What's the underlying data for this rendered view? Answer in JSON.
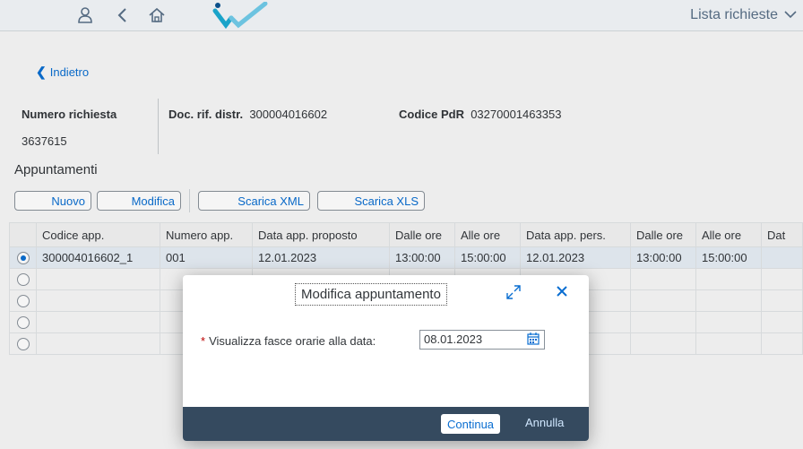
{
  "shell": {
    "title": "Lista richieste",
    "icons": [
      "user-icon",
      "back-arrow-icon",
      "home-icon",
      "logo"
    ]
  },
  "nav": {
    "back_label": "Indietro"
  },
  "header": {
    "request_label": "Numero richiesta",
    "request_value": "3637615",
    "doc_label": "Doc. rif. distr.",
    "doc_value": "300004016602",
    "pdr_label": "Codice PdR",
    "pdr_value": "03270001463353"
  },
  "section_title": "Appuntamenti",
  "toolbar": {
    "nuovo": "Nuovo",
    "modifica": "Modifica",
    "scarica_xml": "Scarica XML",
    "scarica_xls": "Scarica XLS"
  },
  "table": {
    "columns": [
      "Codice app.",
      "Numero app.",
      "Data app. proposto",
      "Dalle ore",
      "Alle ore",
      "Data app. pers.",
      "Dalle ore",
      "Alle ore",
      "Dat"
    ],
    "rows": [
      [
        "300004016602_1",
        "001",
        "12.01.2023",
        "13:00:00",
        "15:00:00",
        "12.01.2023",
        "13:00:00",
        "15:00:00",
        ""
      ],
      [
        "",
        "",
        "",
        "",
        "",
        "",
        "",
        "",
        ""
      ],
      [
        "",
        "",
        "",
        "",
        "",
        "",
        "",
        "",
        ""
      ],
      [
        "",
        "",
        "",
        "",
        "",
        "",
        "",
        "",
        ""
      ],
      [
        "",
        "",
        "",
        "",
        "",
        "",
        "",
        "",
        ""
      ]
    ],
    "selected_row": 0
  },
  "dialog": {
    "title": "Modifica appuntamento",
    "field_label": "Visualizza fasce orarie alla data:",
    "field_value": "08.01.2023",
    "continua": "Continua",
    "annulla": "Annulla"
  },
  "colors": {
    "accent": "#0a6ed1",
    "footer": "#354a5f",
    "required": "#bb0000"
  }
}
